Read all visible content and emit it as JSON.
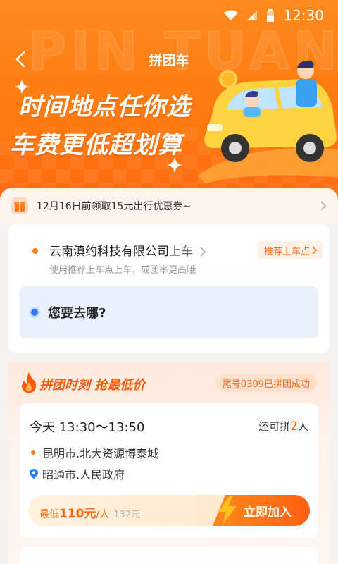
{
  "status_bar": {
    "time": "12:30"
  },
  "header": {
    "title": "拼团车",
    "watermark": "PIN TUAN"
  },
  "hero": {
    "slogan_line1": "时间地点任你选",
    "slogan_line2": "车费更低超划算"
  },
  "coupon": {
    "text": "12月16日前领取15元出行优惠券~"
  },
  "location": {
    "pickup_name": "云南滇约科技有限公司",
    "pickup_suffix": "上车",
    "pickup_hint": "使用推荐上车点上车，成团率更高哦",
    "recommend_button": "推荐上车点",
    "destination_placeholder": "您要去哪?"
  },
  "group": {
    "title": "拼团时刻 抢最低价",
    "success_tag": "尾号0309已拼团成功",
    "trip": {
      "time": "今天  13:30～13:50",
      "seats_prefix": "还可拼",
      "seats_count": "2",
      "seats_suffix": "人",
      "from": "昆明市.北大资源博泰城",
      "to": "昭通市.人民政府",
      "price_prefix": "最低",
      "price": "110元",
      "price_unit": "/人",
      "original_price": "132元",
      "join_button": "立即加入"
    }
  },
  "colors": {
    "brand_orange": "#ff7a0f",
    "accent_blue": "#2c7cf5",
    "price_orange": "#ff5a0a"
  }
}
